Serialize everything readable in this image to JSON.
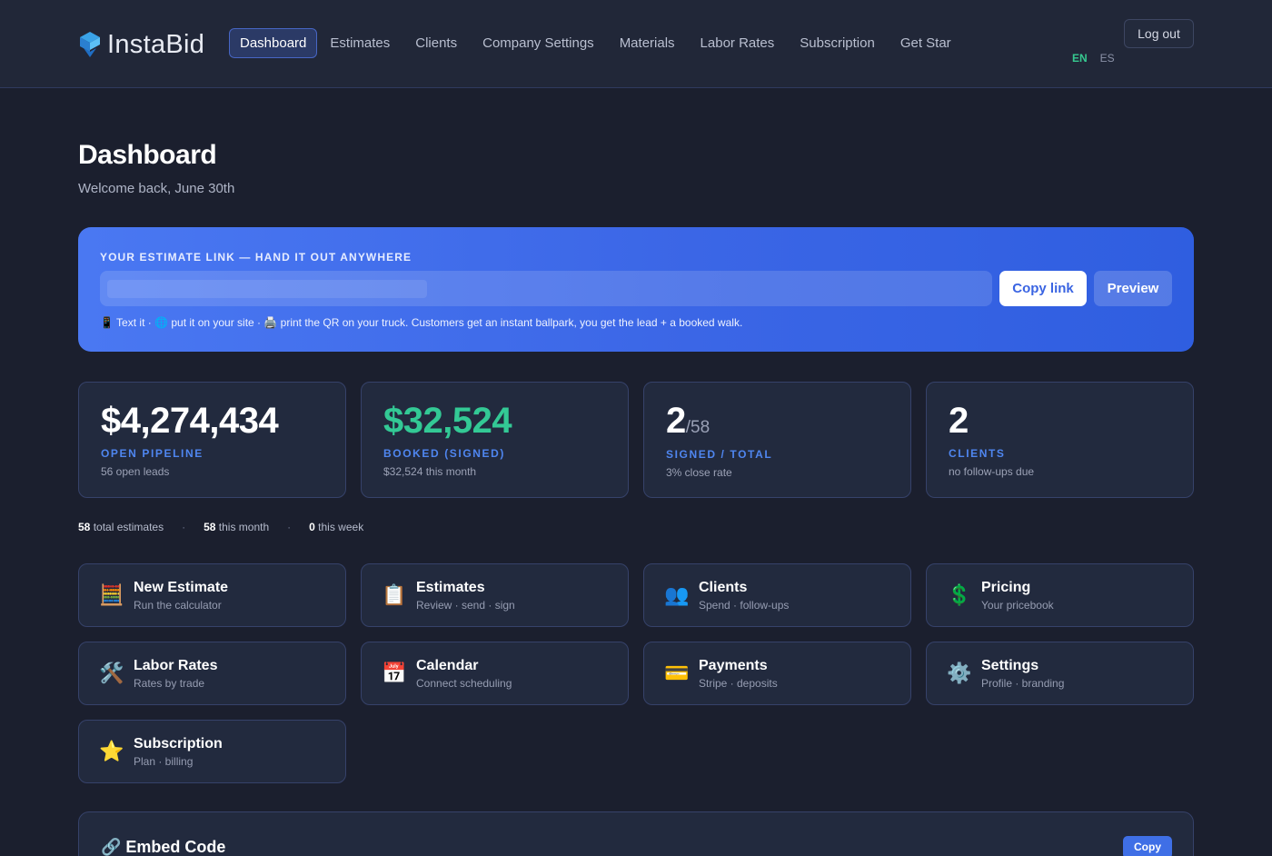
{
  "header": {
    "brand": "InstaBid",
    "nav": [
      {
        "label": "Dashboard",
        "active": true
      },
      {
        "label": "Estimates",
        "active": false
      },
      {
        "label": "Clients",
        "active": false
      },
      {
        "label": "Company Settings",
        "active": false
      },
      {
        "label": "Materials",
        "active": false
      },
      {
        "label": "Labor Rates",
        "active": false
      },
      {
        "label": "Subscription",
        "active": false
      },
      {
        "label": "Get Star",
        "active": false
      }
    ],
    "logout_label": "Log out",
    "lang_en": "EN",
    "lang_es": "ES"
  },
  "page": {
    "title": "Dashboard",
    "subtitle": "Welcome back, June 30th"
  },
  "estimate_link": {
    "label": "YOUR ESTIMATE LINK — HAND IT OUT ANYWHERE",
    "copy_label": "Copy link",
    "preview_label": "Preview",
    "hint": "📱 Text it · 🌐 put it on your site · 🖨️ print the QR on your truck. Customers get an instant ballpark, you get the lead + a booked walk."
  },
  "stats": [
    {
      "value": "$4,274,434",
      "label": "OPEN PIPELINE",
      "note": "56 open leads"
    },
    {
      "value": "$32,524",
      "label": "BOOKED (SIGNED)",
      "note": "$32,524 this month"
    },
    {
      "value": "2",
      "value_suffix": "/58",
      "label": "SIGNED / TOTAL",
      "note": "3% close rate"
    },
    {
      "value": "2",
      "label": "CLIENTS",
      "note": "no follow-ups due"
    }
  ],
  "totals": {
    "total_count": "58",
    "total_text": "total estimates",
    "month_count": "58",
    "month_text": "this month",
    "week_count": "0",
    "week_text": "this week",
    "sep": "·"
  },
  "tiles": [
    {
      "icon": "🧮",
      "icon_name": "abacus-icon",
      "title": "New Estimate",
      "sub": "Run the calculator"
    },
    {
      "icon": "📋",
      "icon_name": "clipboard-icon",
      "title": "Estimates",
      "sub": "Review · send · sign"
    },
    {
      "icon": "👥",
      "icon_name": "people-icon",
      "title": "Clients",
      "sub": "Spend · follow-ups"
    },
    {
      "icon": "💲",
      "icon_name": "dollar-icon",
      "title": "Pricing",
      "sub": "Your pricebook"
    },
    {
      "icon": "🛠️",
      "icon_name": "tools-icon",
      "title": "Labor Rates",
      "sub": "Rates by trade"
    },
    {
      "icon": "📅",
      "icon_name": "calendar-icon",
      "title": "Calendar",
      "sub": "Connect scheduling"
    },
    {
      "icon": "💳",
      "icon_name": "credit-card-icon",
      "title": "Payments",
      "sub": "Stripe · deposits"
    },
    {
      "icon": "⚙️",
      "icon_name": "gear-icon",
      "title": "Settings",
      "sub": "Profile · branding"
    },
    {
      "icon": "⭐",
      "icon_name": "star-icon",
      "title": "Subscription",
      "sub": "Plan · billing"
    }
  ],
  "embed": {
    "title": "🔗 Embed Code",
    "copy_label": "Copy"
  },
  "colors": {
    "background": "#1b1f2e",
    "accent": "#3b66e6",
    "green": "#33c995"
  }
}
